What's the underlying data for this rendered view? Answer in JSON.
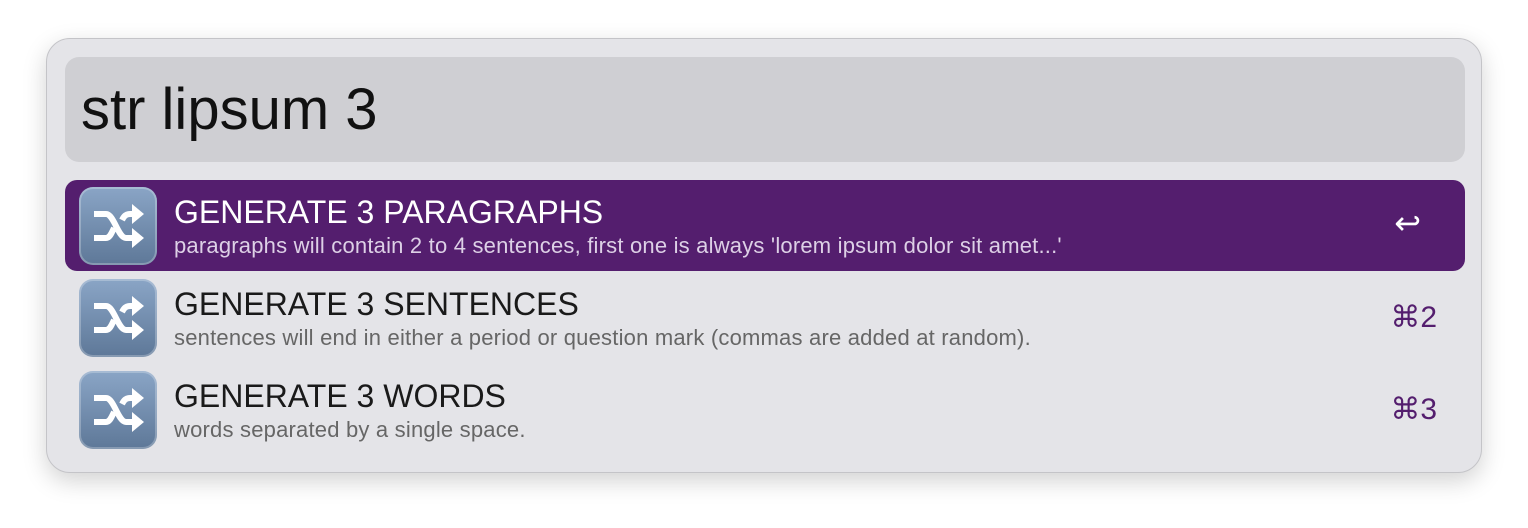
{
  "search": {
    "value": "str lipsum 3"
  },
  "results": [
    {
      "title": "GENERATE 3 PARAGRAPHS",
      "subtitle": "paragraphs will contain 2 to 4 sentences, first one is always 'lorem ipsum dolor sit amet...'",
      "shortcut": "↩",
      "icon": "shuffle-icon",
      "selected": true
    },
    {
      "title": "GENERATE 3 SENTENCES",
      "subtitle": "sentences will end in either a period or question mark (commas are added at random).",
      "shortcut": "⌘2",
      "icon": "shuffle-icon",
      "selected": false
    },
    {
      "title": "GENERATE 3 WORDS",
      "subtitle": "words separated by a single space.",
      "shortcut": "⌘3",
      "icon": "shuffle-icon",
      "selected": false
    }
  ],
  "colors": {
    "accent": "#541e6e",
    "window": "#e4e4e8",
    "search_bg": "#cfcfd3"
  }
}
